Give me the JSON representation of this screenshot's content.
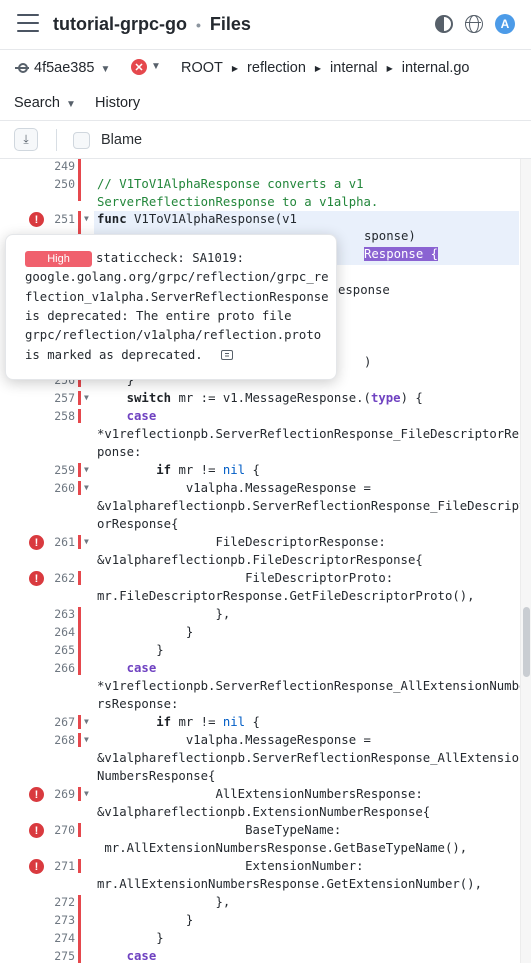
{
  "header": {
    "repo": "tutorial-grpc-go",
    "separator": "•",
    "page": "Files",
    "avatar_letter": "A",
    "icons": [
      "hamburger-menu-icon",
      "contrast-icon",
      "globe-icon"
    ]
  },
  "breadcrumb": {
    "commit": "4f5ae385",
    "status": "error",
    "path": [
      "ROOT",
      "reflection",
      "internal",
      "internal.go"
    ]
  },
  "nav": {
    "search": "Search",
    "history": "History"
  },
  "toolbar": {
    "blame": "Blame"
  },
  "tooltip": {
    "severity": "High",
    "lines": [
      "staticcheck: SA1019:",
      "google.golang.org/grpc/reflection/grpc_re",
      "flection_v1alpha.ServerReflectionResponse",
      "is deprecated: The entire proto file",
      "grpc/reflection/v1alpha/reflection.proto",
      "is marked as deprecated."
    ]
  },
  "code": {
    "visible_fragments": {
      "l252_tail": "sponse)",
      "l253_selected": "Response {",
      "l254_tail": "esponse",
      "l255_tail": ")"
    },
    "lines": [
      {
        "num": "249",
        "text": ""
      },
      {
        "num": "250",
        "text": "// V1ToV1AlphaResponse converts a v1"
      },
      {
        "num": "",
        "text": "ServerReflectionResponse to a v1alpha."
      },
      {
        "num": "251",
        "text": "func V1ToV1AlphaResponse(v1"
      },
      {
        "num": "256",
        "text": "    }"
      },
      {
        "num": "257",
        "text": "    switch mr := v1.MessageResponse.(type) {"
      },
      {
        "num": "258",
        "text": "    case"
      },
      {
        "num": "",
        "text": "*v1reflectionpb.ServerReflectionResponse_FileDescriptorRes"
      },
      {
        "num": "",
        "text": "ponse:"
      },
      {
        "num": "259",
        "text": "        if mr != nil {"
      },
      {
        "num": "260",
        "text": "            v1alpha.MessageResponse ="
      },
      {
        "num": "",
        "text": "&v1alphareflectionpb.ServerReflectionResponse_FileDescript"
      },
      {
        "num": "",
        "text": "orResponse{"
      },
      {
        "num": "261",
        "text": "                FileDescriptorResponse:"
      },
      {
        "num": "",
        "text": "&v1alphareflectionpb.FileDescriptorResponse{"
      },
      {
        "num": "262",
        "text": "                    FileDescriptorProto:"
      },
      {
        "num": "",
        "text": "mr.FileDescriptorResponse.GetFileDescriptorProto(),"
      },
      {
        "num": "263",
        "text": "                },"
      },
      {
        "num": "264",
        "text": "            }"
      },
      {
        "num": "265",
        "text": "        }"
      },
      {
        "num": "266",
        "text": "    case"
      },
      {
        "num": "",
        "text": "*v1reflectionpb.ServerReflectionResponse_AllExtensionNumbe"
      },
      {
        "num": "",
        "text": "rsResponse:"
      },
      {
        "num": "267",
        "text": "        if mr != nil {"
      },
      {
        "num": "268",
        "text": "            v1alpha.MessageResponse ="
      },
      {
        "num": "",
        "text": "&v1alphareflectionpb.ServerReflectionResponse_AllExtension"
      },
      {
        "num": "",
        "text": "NumbersResponse{"
      },
      {
        "num": "269",
        "text": "                AllExtensionNumbersResponse:"
      },
      {
        "num": "",
        "text": "&v1alphareflectionpb.ExtensionNumberResponse{"
      },
      {
        "num": "270",
        "text": "                    BaseTypeName:"
      },
      {
        "num": "",
        "text": " mr.AllExtensionNumbersResponse.GetBaseTypeName(),"
      },
      {
        "num": "271",
        "text": "                    ExtensionNumber:"
      },
      {
        "num": "",
        "text": "mr.AllExtensionNumbersResponse.GetExtensionNumber(),"
      },
      {
        "num": "272",
        "text": "                },"
      },
      {
        "num": "273",
        "text": "            }"
      },
      {
        "num": "274",
        "text": "        }"
      },
      {
        "num": "275",
        "text": "    case"
      }
    ]
  },
  "colors": {
    "error": "#d93a3f",
    "high_badge": "#f0606d",
    "selection": "#8a63d2",
    "highlight": "#e9f0fb",
    "comment": "#22863a",
    "keyword": "#6f42c1"
  }
}
